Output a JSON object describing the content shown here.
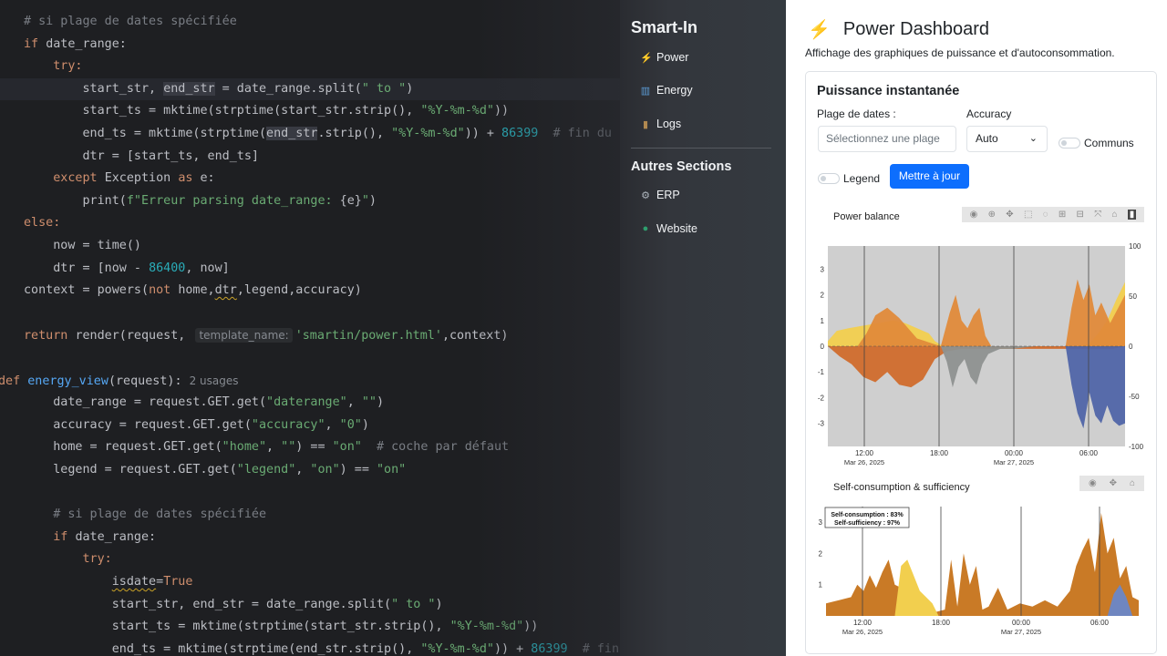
{
  "editor": {
    "lines": [
      [
        [
          "# si plage de dates spécifiée",
          "cm"
        ]
      ],
      [
        [
          "if ",
          "kw"
        ],
        [
          "date_range:",
          ""
        ]
      ],
      [
        [
          "    try:",
          "kw"
        ]
      ],
      [
        [
          "        start_str, ",
          ""
        ],
        [
          "end_str",
          "ref"
        ],
        [
          " = date_range.split(",
          ""
        ],
        [
          "\" to \"",
          "str"
        ],
        [
          ")",
          ""
        ]
      ],
      [
        [
          "        start_ts = mktime(strptime(start_str.strip(), ",
          ""
        ],
        [
          "\"%Y-%m-%d\"",
          "str"
        ],
        [
          "))",
          ""
        ]
      ],
      [
        [
          "        end_ts = mktime(strptime(",
          ""
        ],
        [
          "end_str",
          "ref"
        ],
        [
          ".strip(), ",
          ""
        ],
        [
          "\"%Y-%m-%d\"",
          "str"
        ],
        [
          ")) + ",
          ""
        ],
        [
          "86399",
          "num"
        ],
        [
          "  # fin du jour",
          "cm"
        ]
      ],
      [
        [
          "        dtr = [start_ts, end_ts]",
          ""
        ]
      ],
      [
        [
          "    except ",
          "kw"
        ],
        [
          "Exception ",
          ""
        ],
        [
          "as ",
          "kw"
        ],
        [
          "e:",
          ""
        ]
      ],
      [
        [
          "        print(",
          ""
        ],
        [
          "f\"Erreur parsing date_range: ",
          "str"
        ],
        [
          "{e}",
          ""
        ],
        [
          "\"",
          "str"
        ],
        [
          ")",
          ""
        ]
      ],
      [
        [
          "else:",
          "kw"
        ]
      ],
      [
        [
          "    now = time()",
          ""
        ]
      ],
      [
        [
          "    dtr = [now - ",
          ""
        ],
        [
          "86400",
          "num"
        ],
        [
          ", now]",
          ""
        ]
      ],
      [
        [
          "context = powers(",
          ""
        ],
        [
          "not ",
          "kw"
        ],
        [
          "home,",
          ""
        ],
        [
          "dtr",
          "squig"
        ],
        [
          ",legend,accuracy)",
          ""
        ]
      ],
      [
        [
          "",
          ""
        ]
      ],
      [
        [
          "return ",
          "kw"
        ],
        [
          "render(request, ",
          ""
        ],
        [
          "template_name:",
          "hint"
        ],
        [
          "'smartin/power.html'",
          "str"
        ],
        [
          ",context)",
          ""
        ]
      ],
      [
        [
          "",
          ""
        ]
      ],
      [
        [
          "def ",
          "kw"
        ],
        [
          "energy_view",
          "fn"
        ],
        [
          "(request):",
          ""
        ],
        [
          "2 usages",
          "usage"
        ]
      ],
      [
        [
          "    date_range = request.GET.get(",
          ""
        ],
        [
          "\"daterange\"",
          "str"
        ],
        [
          ", ",
          ""
        ],
        [
          "\"\"",
          "str"
        ],
        [
          ")",
          ""
        ]
      ],
      [
        [
          "    accuracy = request.GET.get(",
          ""
        ],
        [
          "\"accuracy\"",
          "str"
        ],
        [
          ", ",
          ""
        ],
        [
          "\"0\"",
          "str"
        ],
        [
          ")",
          ""
        ]
      ],
      [
        [
          "    home = request.GET.get(",
          ""
        ],
        [
          "\"home\"",
          "str"
        ],
        [
          ", ",
          ""
        ],
        [
          "\"\"",
          "str"
        ],
        [
          ") == ",
          ""
        ],
        [
          "\"on\"",
          "str"
        ],
        [
          "  # coche par défaut",
          "cm"
        ]
      ],
      [
        [
          "    legend = request.GET.get(",
          ""
        ],
        [
          "\"legend\"",
          "str"
        ],
        [
          ", ",
          ""
        ],
        [
          "\"on\"",
          "str"
        ],
        [
          ") == ",
          ""
        ],
        [
          "\"on\"",
          "str"
        ]
      ],
      [
        [
          "",
          ""
        ]
      ],
      [
        [
          "    # si plage de dates spécifiée",
          "cm"
        ]
      ],
      [
        [
          "    if ",
          "kw"
        ],
        [
          "date_range:",
          ""
        ]
      ],
      [
        [
          "        try:",
          "kw"
        ]
      ],
      [
        [
          "            ",
          ""
        ],
        [
          "isdate",
          "squig"
        ],
        [
          "=",
          ""
        ],
        [
          "True",
          "kw"
        ]
      ],
      [
        [
          "            start_str, end_str = date_range.split(",
          ""
        ],
        [
          "\" to \"",
          "str"
        ],
        [
          ")",
          ""
        ]
      ],
      [
        [
          "            start_ts = mktime(strptime(start_str.strip(), ",
          ""
        ],
        [
          "\"%Y-%m-%d\"",
          "str"
        ],
        [
          "))",
          ""
        ]
      ],
      [
        [
          "            end_ts = mktime(strptime(end_str.strip(), ",
          ""
        ],
        [
          "\"%Y-%m-%d\"",
          "str"
        ],
        [
          ")) + ",
          ""
        ],
        [
          "86399",
          "num"
        ],
        [
          "  # fin du jour",
          "cm"
        ]
      ]
    ]
  },
  "sidebar": {
    "brand": "Smart-In",
    "items": [
      {
        "label": "Power",
        "icon": "lightning-icon",
        "glyph": "⚡",
        "color": "#f08a24"
      },
      {
        "label": "Energy",
        "icon": "chart-icon",
        "glyph": "▥",
        "color": "#5b9bd5"
      },
      {
        "label": "Logs",
        "icon": "notebook-icon",
        "glyph": "▮",
        "color": "#b08850"
      }
    ],
    "section_title": "Autres Sections",
    "section_items": [
      {
        "label": "ERP",
        "icon": "gear-icon",
        "glyph": "⚙",
        "color": "#adb5bd"
      },
      {
        "label": "Website",
        "icon": "globe-icon",
        "glyph": "●",
        "color": "#2e9e6e"
      }
    ]
  },
  "main": {
    "title": "Power Dashboard",
    "subtitle": "Affichage des graphiques de puissance et d'autoconsommation.",
    "card": {
      "title": "Puissance instantanée",
      "date_label": "Plage de dates :",
      "date_placeholder": "Sélectionnez une plage",
      "accuracy_label": "Accuracy",
      "accuracy_value": "Auto",
      "communs_label": "Communs",
      "legend_label": "Legend",
      "update_button": "Mettre à jour"
    }
  },
  "chart_data": [
    {
      "type": "area",
      "title": "Power balance",
      "x_ticks": [
        "12:00\nMar 26, 2025",
        "18:00",
        "00:00\nMar 27, 2025",
        "06:00"
      ],
      "y_ticks_left": [
        3,
        2,
        1,
        0,
        -1,
        -2,
        -3
      ],
      "y_ticks_right": [
        100,
        50,
        0,
        -50,
        -100
      ],
      "ylim_left": [
        -3.9,
        3.9
      ],
      "ylim_right": [
        -100,
        100
      ],
      "series": [
        {
          "color": "#f2cf4e",
          "x": [
            0,
            0.03,
            0.07,
            0.12,
            0.17,
            0.22,
            0.26,
            0.3,
            0.34,
            0.36,
            0.38,
            0.45,
            0.55,
            0.65,
            0.75,
            0.8,
            0.84,
            0.88,
            0.91,
            0.94,
            0.97,
            1.0
          ],
          "values": [
            0.2,
            0.6,
            0.7,
            0.8,
            0.9,
            1.0,
            0.9,
            0.7,
            0.5,
            0.2,
            0.05,
            0,
            0,
            0,
            0,
            0,
            0,
            0.1,
            0.5,
            1.0,
            1.8,
            2.5
          ]
        },
        {
          "color": "#e08a3a",
          "x": [
            0,
            0.1,
            0.13,
            0.16,
            0.2,
            0.24,
            0.3,
            0.38,
            0.41,
            0.43,
            0.45,
            0.47,
            0.49,
            0.51,
            0.53,
            0.55,
            0.6,
            0.7,
            0.8,
            0.82,
            0.84,
            0.86,
            0.88,
            0.9,
            0.92,
            0.95,
            1.0
          ],
          "values": [
            0,
            0,
            0.5,
            1.2,
            1.5,
            1.1,
            0.3,
            0,
            1.3,
            2.0,
            1.0,
            0.7,
            1.2,
            1.5,
            0.4,
            0,
            0,
            0,
            0,
            1.5,
            2.6,
            1.8,
            2.4,
            1.2,
            1.7,
            0.9,
            2.0
          ]
        },
        {
          "color": "#d06b2c",
          "x": [
            0,
            0.04,
            0.08,
            0.12,
            0.16,
            0.2,
            0.24,
            0.28,
            0.32,
            0.36,
            0.4,
            0.45,
            0.5,
            0.55,
            0.6,
            0.65,
            0.7,
            0.75,
            0.8,
            0.82,
            0.84,
            0.86,
            0.88,
            0.9,
            0.92,
            0.96,
            1.0
          ],
          "values": [
            0,
            -0.4,
            -0.7,
            -1.2,
            -1.4,
            -1.0,
            -1.5,
            -1.6,
            -1.3,
            -0.5,
            -0.2,
            -0.1,
            -0.1,
            -0.1,
            -0.1,
            -0.1,
            -0.1,
            -0.1,
            -0.1,
            -0.1,
            -0.1,
            -0.1,
            -0.1,
            -0.1,
            -0.1,
            -0.1,
            0
          ]
        },
        {
          "color": "#8e9190",
          "x": [
            0.38,
            0.4,
            0.42,
            0.44,
            0.46,
            0.48,
            0.5,
            0.52,
            0.54,
            0.56,
            0.58,
            0.62,
            0.7,
            0.8
          ],
          "values": [
            0,
            -0.6,
            -1.6,
            -0.8,
            -0.5,
            -1.2,
            -1.5,
            -0.7,
            -0.3,
            -0.2,
            -0.1,
            -0.1,
            0,
            0
          ]
        },
        {
          "color": "#5065a8",
          "x": [
            0.8,
            0.82,
            0.84,
            0.86,
            0.88,
            0.9,
            0.92,
            0.94,
            0.96,
            0.98,
            1.0
          ],
          "values": [
            0,
            -1.5,
            -2.6,
            -3.2,
            -1.8,
            -2.7,
            -3.0,
            -2.3,
            -2.9,
            -3.1,
            -3.0
          ]
        }
      ]
    },
    {
      "type": "area",
      "title": "Self-consumption & sufficiency",
      "annotation": [
        "Self-consumption : 83%",
        "Self-sufficiency : 97%"
      ],
      "x_ticks": [
        "12:00\nMar 26, 2025",
        "18:00",
        "00:00\nMar 27, 2025",
        "06:00"
      ],
      "y_ticks": [
        3,
        2,
        1
      ],
      "ylim": [
        0,
        3.5
      ],
      "series": [
        {
          "color": "#c97a26",
          "x": [
            0,
            0.04,
            0.08,
            0.1,
            0.12,
            0.14,
            0.16,
            0.18,
            0.2,
            0.22,
            0.24,
            0.26,
            0.3,
            0.34,
            0.38,
            0.4,
            0.42,
            0.44,
            0.46,
            0.48,
            0.5,
            0.52,
            0.55,
            0.58,
            0.62,
            0.66,
            0.7,
            0.74,
            0.78,
            0.8,
            0.82,
            0.84,
            0.86,
            0.88,
            0.9,
            0.92,
            0.94,
            0.96,
            0.98,
            1.0
          ],
          "values": [
            0.4,
            0.5,
            0.6,
            1.0,
            0.8,
            1.3,
            0.9,
            1.4,
            1.8,
            1.0,
            0.9,
            0.5,
            0.2,
            0.1,
            0.2,
            1.8,
            0.3,
            2.0,
            1.0,
            1.6,
            0.2,
            0.3,
            0.9,
            0.2,
            0.4,
            0.3,
            0.5,
            0.3,
            0.8,
            1.6,
            2.1,
            2.5,
            1.4,
            3.3,
            2.0,
            2.5,
            1.2,
            1.6,
            0.6,
            0.5
          ]
        },
        {
          "color": "#f2cf4e",
          "x": [
            0.22,
            0.24,
            0.26,
            0.28,
            0.3,
            0.32,
            0.34,
            0.36
          ],
          "values": [
            0,
            1.6,
            1.8,
            1.3,
            0.8,
            0.6,
            0.4,
            0
          ]
        },
        {
          "color": "#6f86c0",
          "x": [
            0.9,
            0.92,
            0.94,
            0.96,
            0.98
          ],
          "values": [
            0,
            0.7,
            1.0,
            0.6,
            0
          ]
        }
      ]
    }
  ]
}
